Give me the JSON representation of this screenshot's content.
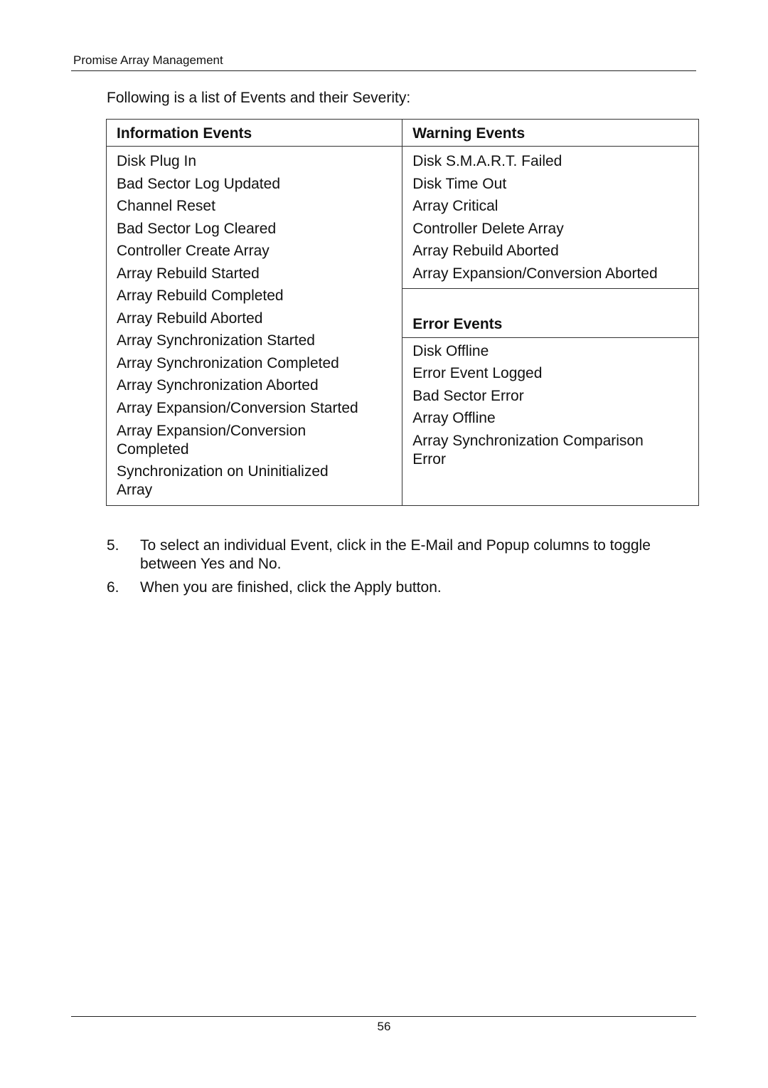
{
  "header": {
    "running_title": "Promise Array Management"
  },
  "intro": "Following is a list of Events and their Severity:",
  "table": {
    "information": {
      "title": "Information Events",
      "items": [
        "Disk Plug In",
        "Bad Sector Log Updated",
        "Channel Reset",
        "Bad Sector Log Cleared",
        "Controller Create Array",
        "Array Rebuild Started",
        "Array Rebuild Completed",
        "Array Rebuild Aborted",
        "Array Synchronization Started",
        "Array Synchronization Completed",
        "Array Synchronization Aborted",
        "Array Expansion/Conversion Started",
        "Array Expansion/Conversion Completed",
        "Synchronization on Uninitialized Array"
      ]
    },
    "warning": {
      "title": "Warning Events",
      "items": [
        "Disk S.M.A.R.T. Failed",
        "Disk Time Out",
        "Array Critical",
        "Controller Delete Array",
        "Array Rebuild Aborted",
        "Array Expansion/Conversion Aborted"
      ]
    },
    "error": {
      "title": "Error Events",
      "items": [
        "Disk Offline",
        "Error Event Logged",
        "Bad Sector Error",
        "Array Offline",
        "Array Synchronization Comparison Error"
      ]
    }
  },
  "steps": [
    {
      "number": "5.",
      "text": "To select an individual Event, click in the E-Mail and Popup columns to toggle between Yes and No."
    },
    {
      "number": "6.",
      "text": "When you are finished, click the Apply button."
    }
  ],
  "footer": {
    "page_number": "56"
  }
}
